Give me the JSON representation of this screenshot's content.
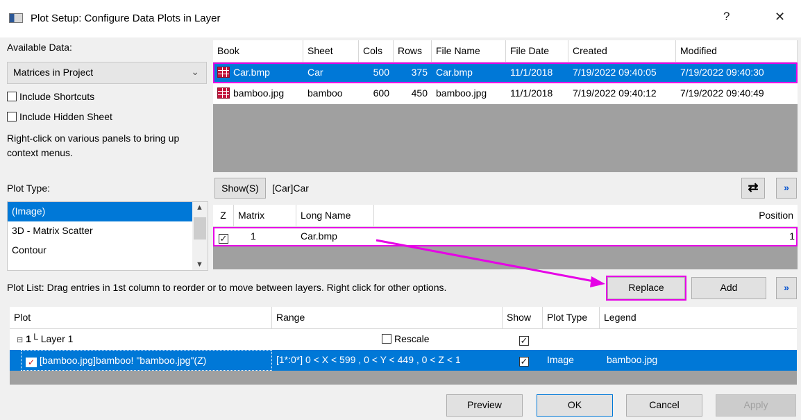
{
  "window": {
    "title": "Plot Setup: Configure Data Plots in Layer",
    "help_glyph": "?",
    "close_glyph": "✕"
  },
  "left": {
    "available_data_label": "Available Data:",
    "source_selected": "Matrices in Project",
    "include_shortcuts": "Include Shortcuts",
    "include_hidden": "Include Hidden Sheet",
    "hint": "Right-click on various panels to bring up context menus.",
    "plot_type_label": "Plot Type:",
    "plot_types": [
      "(Image)",
      "3D - Matrix Scatter",
      "Contour"
    ]
  },
  "books": {
    "columns": [
      "Book",
      "Sheet",
      "Cols",
      "Rows",
      "File Name",
      "File Date",
      "Created",
      "Modified"
    ],
    "rows": [
      [
        "Car.bmp",
        "Car",
        "500",
        "375",
        "Car.bmp",
        "11/1/2018",
        "7/19/2022 09:40:05",
        "7/19/2022 09:40:30"
      ],
      [
        "bamboo.jpg",
        "bamboo",
        "600",
        "450",
        "bamboo.jpg",
        "11/1/2018",
        "7/19/2022 09:40:12",
        "7/19/2022 09:40:49"
      ]
    ]
  },
  "matrix": {
    "show_button": "Show(S)",
    "current": "[Car]Car",
    "columns": [
      "Z",
      "Matrix",
      "Long Name",
      "Position"
    ],
    "row": {
      "matrix": "1",
      "long_name": "Car.bmp",
      "position": "1"
    }
  },
  "plotlist": {
    "hint": "Plot List: Drag entries in 1st column to reorder or to move between layers. Right click for other options.",
    "replace": "Replace",
    "add": "Add",
    "columns": [
      "Plot",
      "Range",
      "Show",
      "Plot Type",
      "Legend"
    ],
    "layer": "Layer 1",
    "rescale": "Rescale",
    "plot": {
      "name": "[bamboo.jpg]bamboo! \"bamboo.jpg\"(Z)",
      "range": "[1*:0*]  0 < X < 599 , 0 < Y < 449 , 0 < Z < 1",
      "type": "Image",
      "legend": "bamboo.jpg"
    }
  },
  "footer": {
    "preview": "Preview",
    "ok": "OK",
    "cancel": "Cancel",
    "apply": "Apply"
  },
  "colors": {
    "selection": "#0078d7",
    "highlight": "#e600e6",
    "gray_area": "#a0a0a0"
  }
}
